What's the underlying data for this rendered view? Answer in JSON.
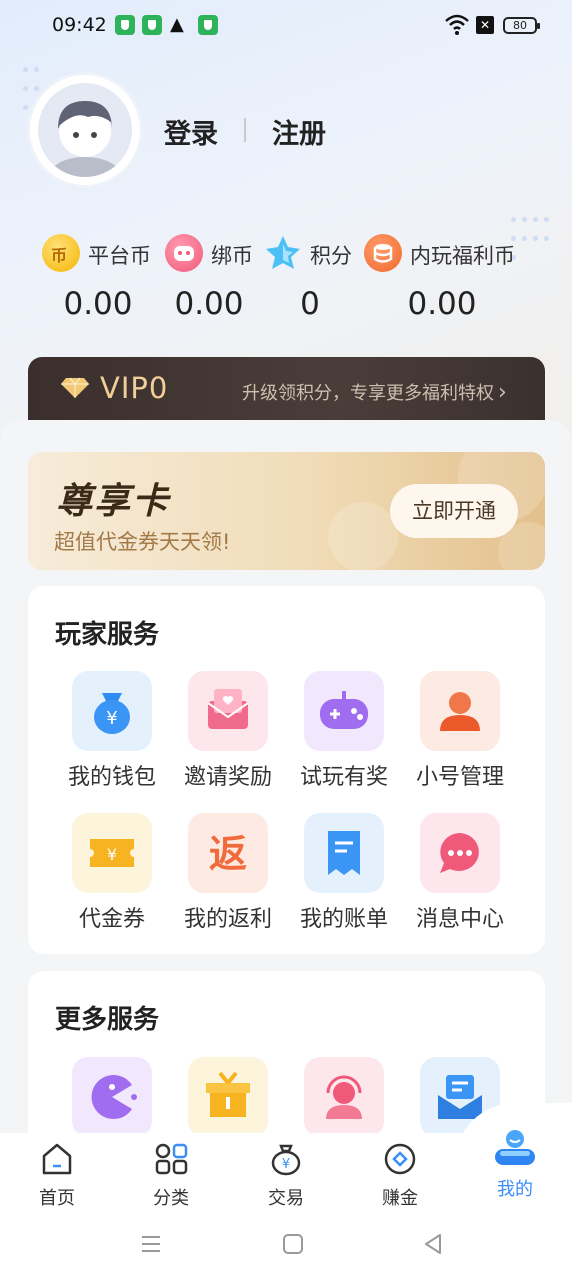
{
  "status_bar": {
    "time": "09:42",
    "battery": "80"
  },
  "profile": {
    "login": "登录",
    "register": "注册"
  },
  "currencies": [
    {
      "label": "平台币",
      "value": "0.00",
      "icon": "platform-coin-icon",
      "icon_text": "币"
    },
    {
      "label": "绑币",
      "value": "0.00",
      "icon": "bound-coin-icon"
    },
    {
      "label": "积分",
      "value": "0",
      "icon": "points-star-icon"
    },
    {
      "label": "内玩福利币",
      "value": "0.00",
      "icon": "welfare-coin-icon"
    }
  ],
  "vip": {
    "level": "VIP0",
    "hint": "升级领积分，专享更多福利特权"
  },
  "vip_card": {
    "title": "尊享卡",
    "subtitle": "超值代金券天天领!",
    "button": "立即开通"
  },
  "player_services": {
    "title": "玩家服务",
    "items": [
      {
        "label": "我的钱包",
        "icon": "wallet-icon",
        "glyph": "¥"
      },
      {
        "label": "邀请奖励",
        "icon": "invite-reward-icon"
      },
      {
        "label": "试玩有奖",
        "icon": "gamepad-icon"
      },
      {
        "label": "小号管理",
        "icon": "account-manage-icon"
      },
      {
        "label": "代金券",
        "icon": "voucher-icon",
        "glyph": "¥"
      },
      {
        "label": "我的返利",
        "icon": "rebate-icon",
        "glyph": "返"
      },
      {
        "label": "我的账单",
        "icon": "bill-icon"
      },
      {
        "label": "消息中心",
        "icon": "message-icon"
      }
    ]
  },
  "more_services": {
    "title": "更多服务",
    "items": [
      {
        "icon": "pacman-game-icon"
      },
      {
        "icon": "gift-box-icon"
      },
      {
        "icon": "customer-service-icon"
      },
      {
        "icon": "mail-icon"
      }
    ]
  },
  "tabbar": [
    {
      "label": "首页",
      "icon": "home-icon"
    },
    {
      "label": "分类",
      "icon": "category-icon"
    },
    {
      "label": "交易",
      "icon": "trade-icon",
      "glyph": "¥"
    },
    {
      "label": "赚金",
      "icon": "earn-icon"
    },
    {
      "label": "我的",
      "icon": "profile-icon",
      "active": true
    }
  ],
  "colors": {
    "accent": "#3a8ef6",
    "vip_gold": "#f2cf98",
    "card_gold": "#e3c08c"
  }
}
